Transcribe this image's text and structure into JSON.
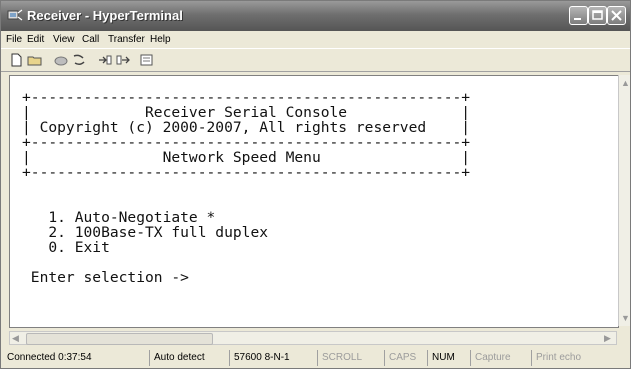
{
  "window": {
    "title": "Receiver - HyperTerminal"
  },
  "menu": [
    "File",
    "Edit",
    "View",
    "Call",
    "Transfer",
    "Help"
  ],
  "toolbar": [
    "new-file-icon",
    "open-folder-icon",
    "call-icon",
    "disconnect-icon",
    "send-icon",
    "receive-icon",
    "properties-icon"
  ],
  "terminal": {
    "lines": [
      "+-------------------------------------------------+",
      "|             Receiver Serial Console             |",
      "| Copyright (c) 2000-2007, All rights reserved    |",
      "+-------------------------------------------------+",
      "|               Network Speed Menu                |",
      "+-------------------------------------------------+",
      "",
      "",
      "   1. Auto-Negotiate *",
      "   2. 100Base-TX full duplex",
      "   0. Exit",
      "",
      " Enter selection ->"
    ]
  },
  "status": {
    "connected": "Connected 0:37:54",
    "detect": "Auto detect",
    "port": "57600 8-N-1",
    "scroll": "SCROLL",
    "caps": "CAPS",
    "num": "NUM",
    "capture": "Capture",
    "print_echo": "Print echo"
  }
}
